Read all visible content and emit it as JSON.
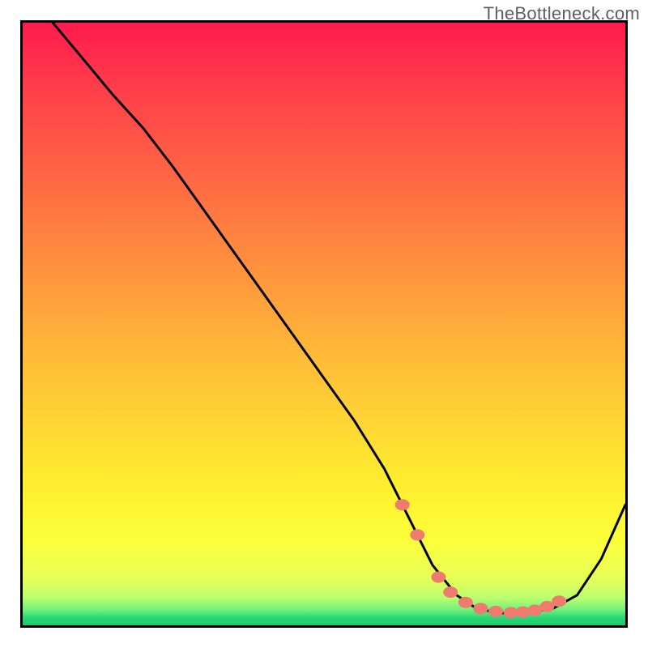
{
  "watermark": "TheBottleneck.com",
  "chart_data": {
    "type": "line",
    "title": "",
    "xlabel": "",
    "ylabel": "",
    "xlim": [
      0,
      100
    ],
    "ylim": [
      0,
      100
    ],
    "grid": false,
    "legend": false,
    "series": [
      {
        "name": "bottleneck-curve",
        "color": "#000000",
        "x": [
          5,
          10,
          15,
          20,
          25,
          30,
          35,
          40,
          45,
          50,
          55,
          60,
          62,
          65,
          68,
          72,
          75,
          78,
          80,
          82,
          85,
          88,
          92,
          96,
          100
        ],
        "y": [
          100,
          94,
          88,
          82.5,
          76,
          69,
          62,
          55,
          48,
          41,
          34,
          26,
          22,
          16,
          10,
          5,
          3,
          2.2,
          2,
          2,
          2.3,
          2.8,
          5,
          11,
          20
        ]
      }
    ],
    "markers": {
      "name": "highlight-dots",
      "color": "#ee7b6e",
      "x": [
        63,
        65.5,
        69,
        71,
        73.5,
        76,
        78.5,
        81,
        83,
        85,
        87,
        89
      ],
      "y": [
        20,
        15,
        8,
        5.5,
        3.8,
        2.8,
        2.3,
        2.1,
        2.2,
        2.5,
        3.1,
        4.0
      ]
    },
    "background": {
      "type": "vertical-gradient",
      "stops": [
        {
          "pos": 0.0,
          "color": "#ff1a4d"
        },
        {
          "pos": 0.5,
          "color": "#ffb13a"
        },
        {
          "pos": 0.8,
          "color": "#fff12f"
        },
        {
          "pos": 0.96,
          "color": "#baff70"
        },
        {
          "pos": 1.0,
          "color": "#1acb6d"
        }
      ]
    }
  }
}
